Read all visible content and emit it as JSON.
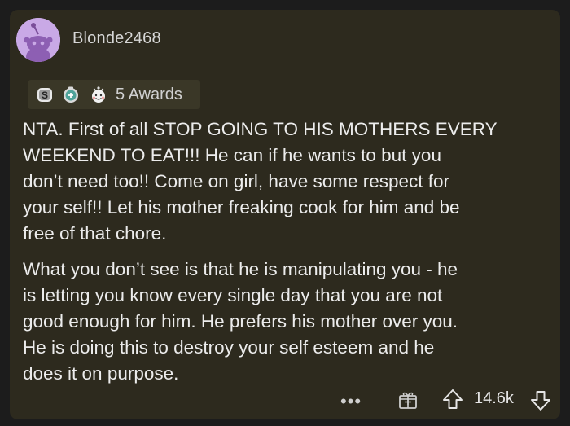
{
  "comment": {
    "username": "Blonde2468",
    "awards": {
      "count_label": "5 Awards",
      "icons": [
        "silver-award-icon",
        "helpful-award-icon",
        "wholesome-award-icon"
      ]
    },
    "paragraphs": [
      "NTA. First of all STOP GOING TO HIS MOTHERS EVERY\nWEEKEND TO EAT!!!  He can if he wants to but you\ndon’t need too!!  Come on girl, have some respect for\nyour self!!  Let his mother freaking cook for him and be\nfree of that chore.",
      "What you don’t see is that he is manipulating you - he\nis letting you know every single day that you are not\ngood enough for him. He prefers his mother over you.\nHe is doing this to destroy your self esteem and he\ndoes it on purpose."
    ],
    "footer": {
      "more_label": "•••",
      "vote_count": "14.6k",
      "icons": [
        "more-options-icon",
        "give-award-icon",
        "upvote-icon",
        "downvote-icon"
      ]
    }
  },
  "colors": {
    "card_background": "#2d2a1e",
    "page_background": "#1c1c1c",
    "text": "#ececec",
    "avatar": "#c9a9e6"
  }
}
